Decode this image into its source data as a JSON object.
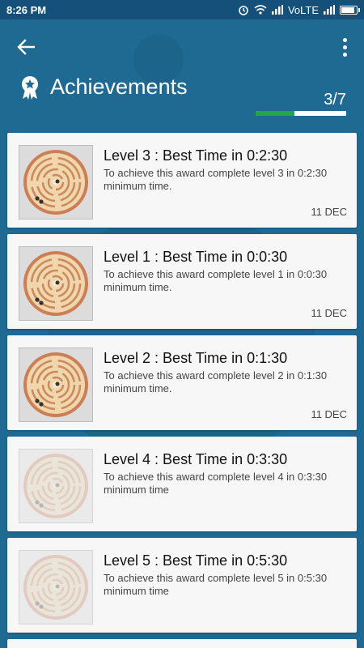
{
  "status_bar": {
    "time": "8:26 PM",
    "network": "VoLTE"
  },
  "app_bar": {
    "title": "Achievements",
    "progress_text": "3/7",
    "progress_fraction": 0.43
  },
  "colors": {
    "background": "#1f6a93",
    "status_bar": "#14507a",
    "progress_fill": "#1ea84b",
    "card": "#f7f7f7"
  },
  "achievements": [
    {
      "title": "Level 3 : Best Time in 0:2:30",
      "description": "To achieve this award  complete level 3 in 0:2:30 minimum time.",
      "date": "11 DEC",
      "unlocked": true
    },
    {
      "title": "Level 1 : Best Time in 0:0:30",
      "description": "To achieve this award  complete level 1 in 0:0:30 minimum time.",
      "date": "11 DEC",
      "unlocked": true
    },
    {
      "title": "Level 2 : Best Time in 0:1:30",
      "description": "To achieve this award  complete level 2 in 0:1:30 minimum time.",
      "date": "11 DEC",
      "unlocked": true
    },
    {
      "title": "Level 4 : Best Time in 0:3:30",
      "description": "To achieve this award  complete level 4 in 0:3:30 minimum time",
      "date": "",
      "unlocked": false
    },
    {
      "title": "Level 5 : Best Time in 0:5:30",
      "description": "To achieve this award  complete level 5 in 0:5:30 minimum time",
      "date": "",
      "unlocked": false
    }
  ],
  "icons": {
    "back": "arrow-back-icon",
    "menu": "more-vert-icon",
    "award": "award-ribbon-icon",
    "thumb": "maze-ball-icon"
  }
}
